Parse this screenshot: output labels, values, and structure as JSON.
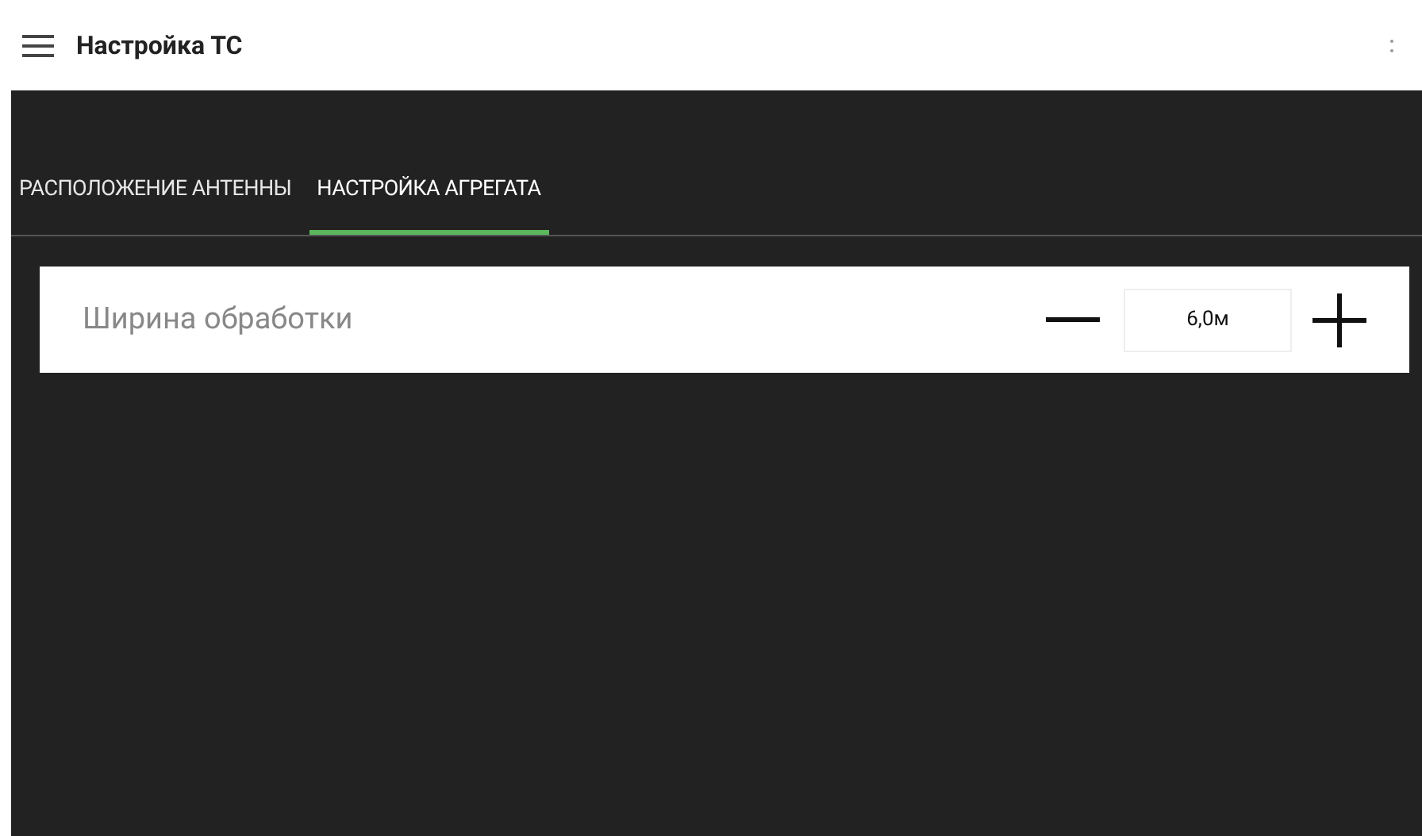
{
  "app_bar": {
    "title": "Настройка ТС"
  },
  "tabs": [
    {
      "label": "РАСПОЛОЖЕНИЕ АНТЕННЫ",
      "selected": false
    },
    {
      "label": "НАСТРОЙКА АГРЕГАТА",
      "selected": true
    }
  ],
  "settings": [
    {
      "label": "Ширина обработки",
      "value": "6,0м"
    }
  ]
}
